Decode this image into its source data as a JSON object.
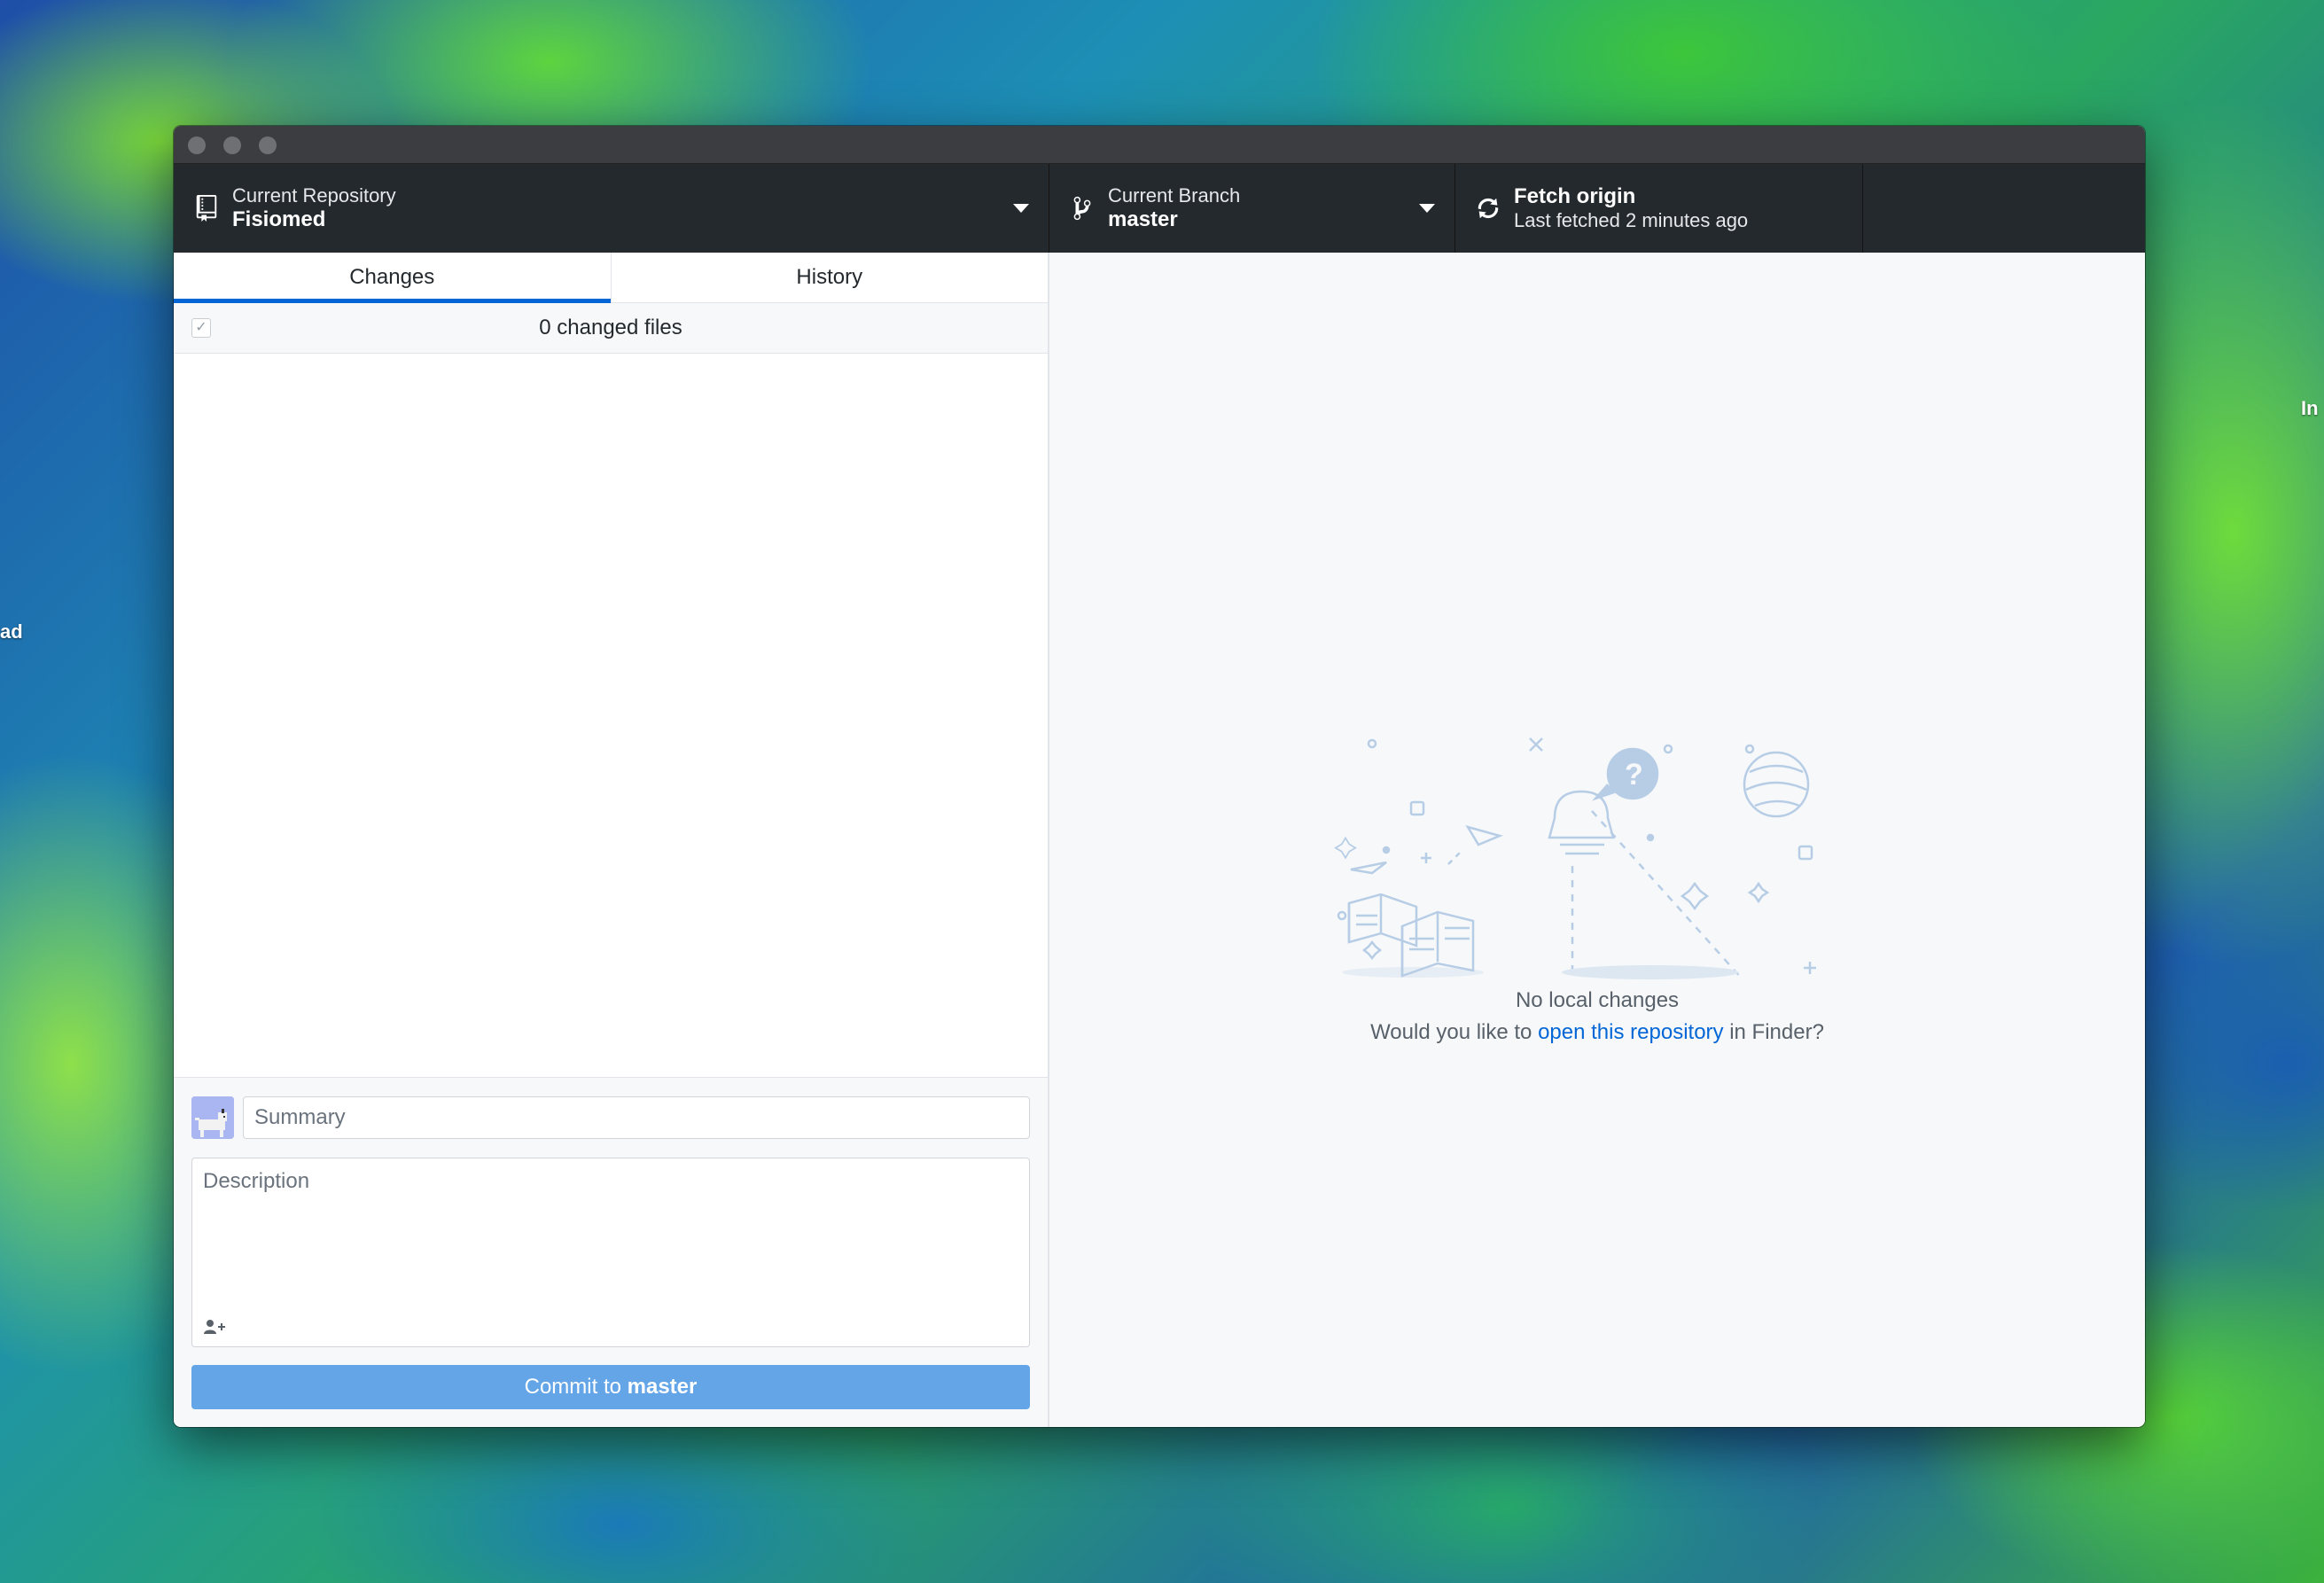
{
  "desktop": {
    "left_label": "ad",
    "right_label": "In"
  },
  "toolbar": {
    "repository": {
      "label": "Current Repository",
      "value": "Fisiomed",
      "icon": "repo-icon"
    },
    "branch": {
      "label": "Current Branch",
      "value": "master",
      "icon": "git-branch-icon"
    },
    "fetch": {
      "label": "Fetch origin",
      "status": "Last fetched 2 minutes ago",
      "icon": "sync-icon"
    }
  },
  "tabs": {
    "changes": "Changes",
    "history": "History",
    "active": "changes"
  },
  "changes": {
    "count_label": "0 changed files",
    "select_all_checked": true
  },
  "commit": {
    "summary_placeholder": "Summary",
    "summary_value": "",
    "description_placeholder": "Description",
    "button_prefix": "Commit to ",
    "button_branch": "master"
  },
  "blank_slate": {
    "title": "No local changes",
    "prompt_before": "Would you like to ",
    "link_text": "open this repository",
    "prompt_after": " in Finder?"
  },
  "colors": {
    "toolbar_bg": "#24292e",
    "accent": "#0366d6",
    "commit_button": "#64a5e8",
    "illustration": "#b7cde6"
  }
}
